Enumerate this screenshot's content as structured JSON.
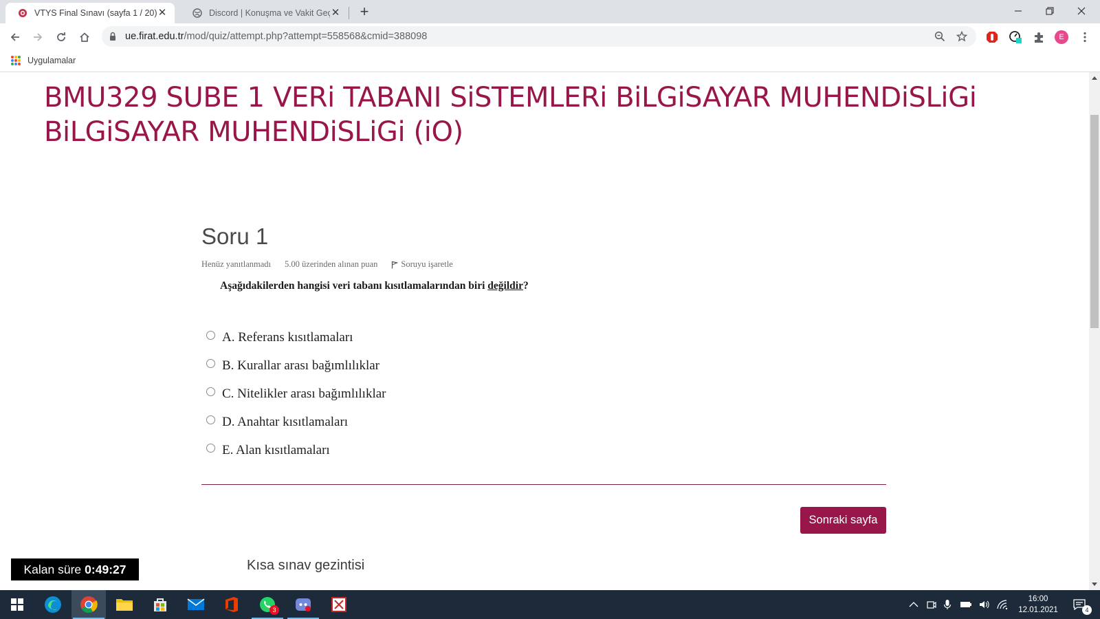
{
  "browser": {
    "tabs": [
      {
        "title": "VTYS Final Sınavı (sayfa 1 / 20)",
        "active": true
      },
      {
        "title": "Discord | Konuşma ve Vakit Geçir",
        "active": false
      }
    ],
    "url_host": "ue.firat.edu.tr",
    "url_path": "/mod/quiz/attempt.php?attempt=558568&cmid=388098",
    "avatar_letter": "E",
    "bookmarks_apps_label": "Uygulamalar"
  },
  "page": {
    "course_title": "BMU329 SUBE 1 VERi TABANI SiSTEMLERi BiLGiSAYAR MUHENDiSLiGi BiLGiSAYAR MUHENDiSLiGi (iO)",
    "question_heading": "Soru 1",
    "question_state": "Henüz yanıtlanmadı",
    "question_grade": "5.00 üzerinden alınan puan",
    "flag_label": "Soruyu işaretle",
    "question_text_before": "Aşağıdakilerden hangisi veri tabanı kısıtlamalarından biri ",
    "question_text_emphasis": "değildir",
    "question_text_after": "?",
    "options": [
      "A. Referans kısıtlamaları",
      "B. Kurallar arası bağımlılıklar",
      "C. Nitelikler arası bağımlılıklar",
      "D. Anahtar kısıtlamaları",
      "E. Alan kısıtlamaları"
    ],
    "next_button": "Sonraki sayfa",
    "quiz_nav_title": "Kısa sınav gezintisi",
    "timer_label": "Kalan süre",
    "timer_value": "0:49:27"
  },
  "taskbar": {
    "time": "16:00",
    "date": "12.01.2021",
    "whatsapp_badge": "3",
    "notification_count": "4"
  },
  "colors": {
    "brand": "#98164a",
    "taskbar": "#1c2a3a"
  }
}
